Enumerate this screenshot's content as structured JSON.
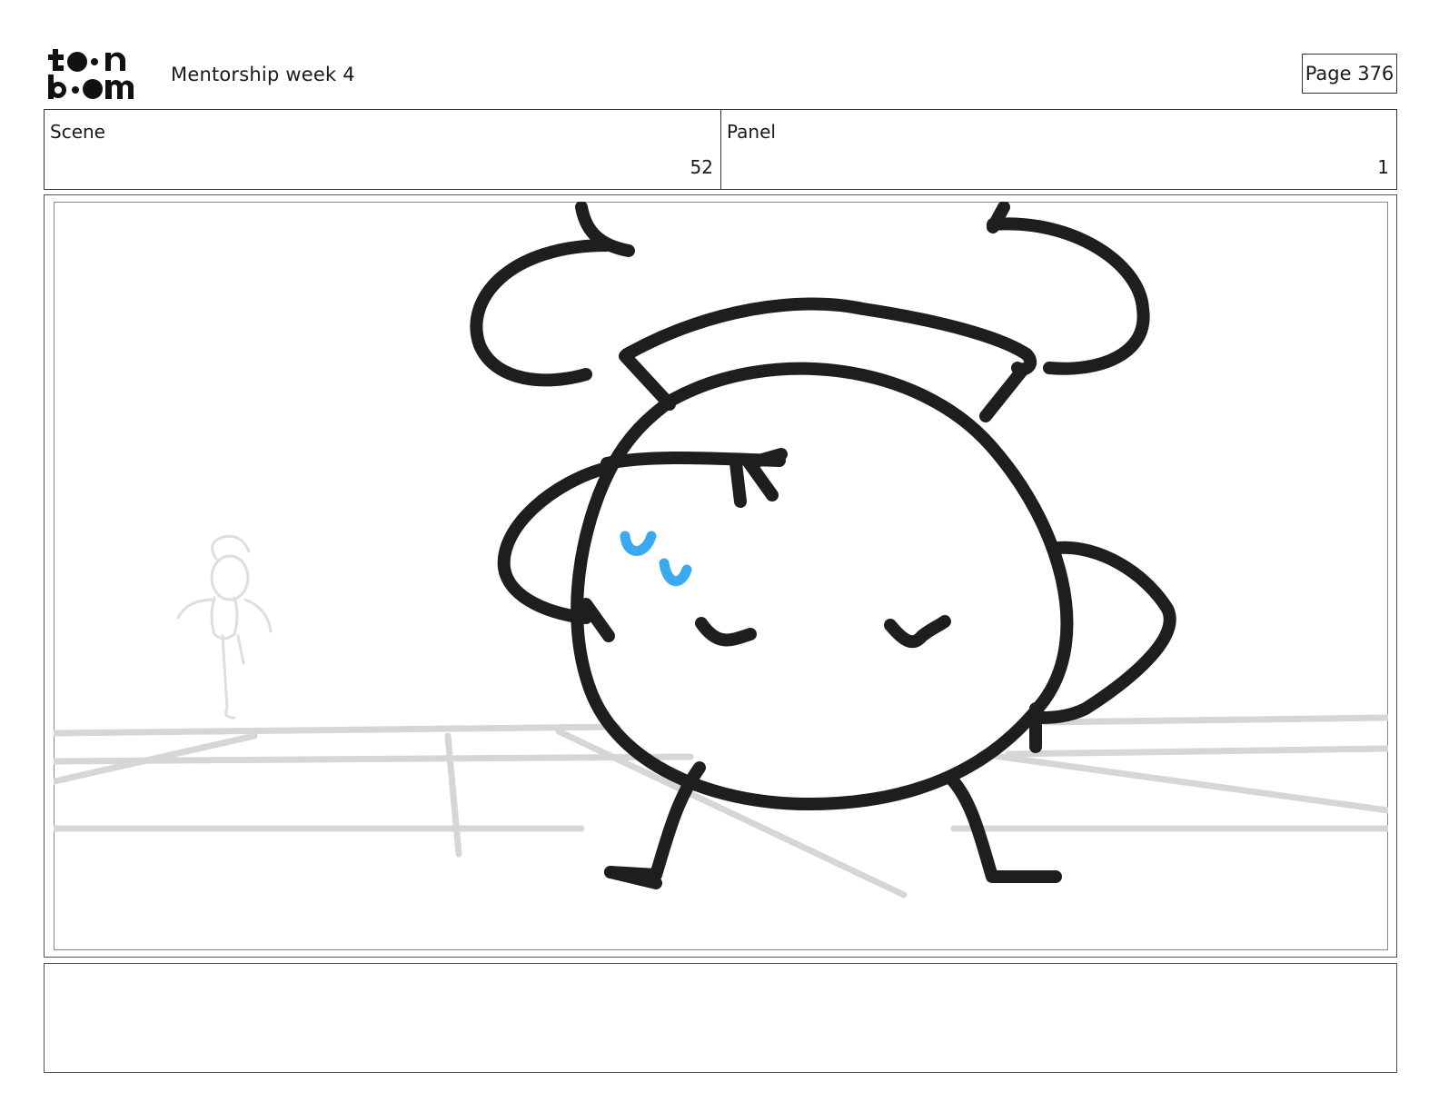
{
  "header": {
    "logo_name": "toon boom",
    "document_title": "Mentorship week 4",
    "page_label": "Page 376"
  },
  "info": {
    "scene_label": "Scene",
    "scene_value": "52",
    "panel_label": "Panel",
    "panel_value": "1"
  },
  "colors": {
    "ink": "#1e1e1e",
    "sketch_gray": "#d6d6d6",
    "tear_blue": "#3aaaf0",
    "border": "#333333"
  },
  "notes": {
    "text": ""
  }
}
